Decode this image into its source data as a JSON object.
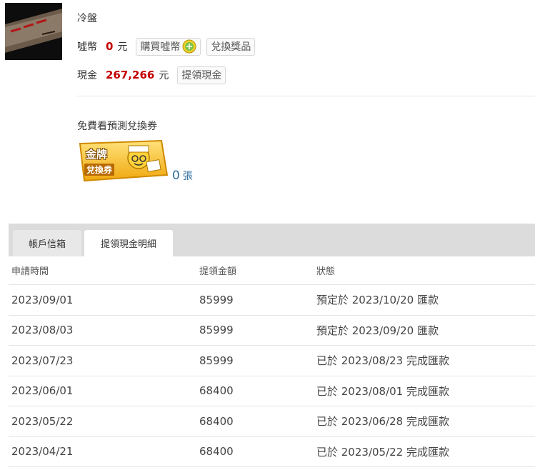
{
  "user": {
    "name": "冷盤"
  },
  "coins": {
    "label": "噓幣",
    "amount": "0",
    "unit": "元",
    "buy_label": "購買噓幣",
    "redeem_label": "兌換獎品"
  },
  "cash": {
    "label": "現金",
    "amount": "267,266",
    "unit": "元",
    "withdraw_label": "提領現金"
  },
  "coupon": {
    "title": "免費看預測兌換券",
    "badge_line1": "金牌",
    "badge_line2": "兌換券",
    "count": "0",
    "count_unit": "張"
  },
  "tabs": [
    {
      "label": "帳戶信箱",
      "active": false
    },
    {
      "label": "提領現金明細",
      "active": true
    }
  ],
  "table": {
    "headers": [
      "申請時間",
      "提領金額",
      "狀態"
    ],
    "rows": [
      [
        "2023/09/01",
        "85999",
        "預定於 2023/10/20 匯款"
      ],
      [
        "2023/08/03",
        "85999",
        "預定於 2023/09/20 匯款"
      ],
      [
        "2023/07/23",
        "85999",
        "已於 2023/08/23 完成匯款"
      ],
      [
        "2023/06/01",
        "68400",
        "已於 2023/08/01 完成匯款"
      ],
      [
        "2023/05/22",
        "68400",
        "已於 2023/06/28 完成匯款"
      ],
      [
        "2023/04/21",
        "68400",
        "已於 2023/05/22 完成匯款"
      ]
    ]
  },
  "colors": {
    "amount": "#c40000",
    "link": "#2a6b9b",
    "tabbar": "#dcdcdc"
  }
}
